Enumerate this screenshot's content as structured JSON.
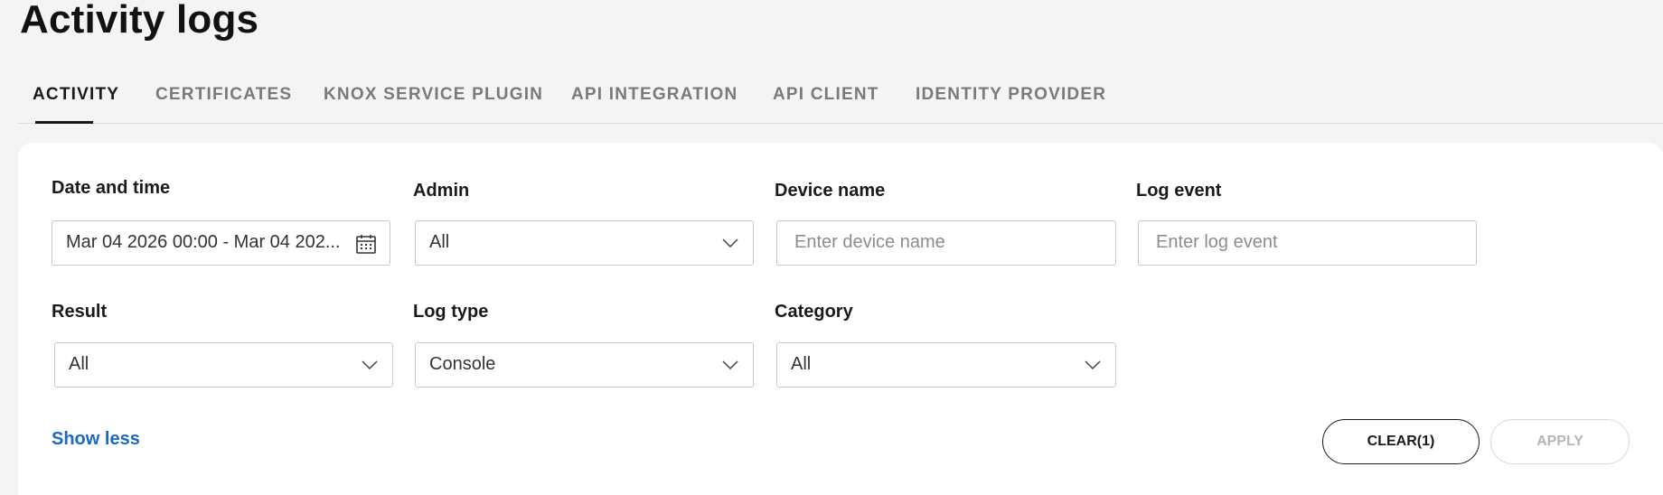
{
  "page": {
    "title": "Activity logs"
  },
  "tabs": [
    {
      "label": "ACTIVITY",
      "active": true
    },
    {
      "label": "CERTIFICATES",
      "active": false
    },
    {
      "label": "KNOX SERVICE PLUGIN",
      "active": false
    },
    {
      "label": "API INTEGRATION",
      "active": false
    },
    {
      "label": "API CLIENT",
      "active": false
    },
    {
      "label": "IDENTITY PROVIDER",
      "active": false
    }
  ],
  "filters": {
    "date_time": {
      "label": "Date and time",
      "value": "Mar 04 2026 00:00 - Mar 04 202..."
    },
    "admin": {
      "label": "Admin",
      "value": "All"
    },
    "device_name": {
      "label": "Device name",
      "placeholder": "Enter device name",
      "value": ""
    },
    "log_event": {
      "label": "Log event",
      "placeholder": "Enter log event",
      "value": ""
    },
    "result": {
      "label": "Result",
      "value": "All"
    },
    "log_type": {
      "label": "Log type",
      "value": "Console"
    },
    "category": {
      "label": "Category",
      "value": "All"
    }
  },
  "actions": {
    "show_less": "Show less",
    "clear": "CLEAR(1)",
    "apply": "APPLY"
  },
  "icons": {
    "calendar": "calendar-icon",
    "dropdown": "chevron-down-icon"
  },
  "colors": {
    "link": "#1b66c9",
    "background": "#f4f4f4",
    "card": "#ffffff"
  }
}
